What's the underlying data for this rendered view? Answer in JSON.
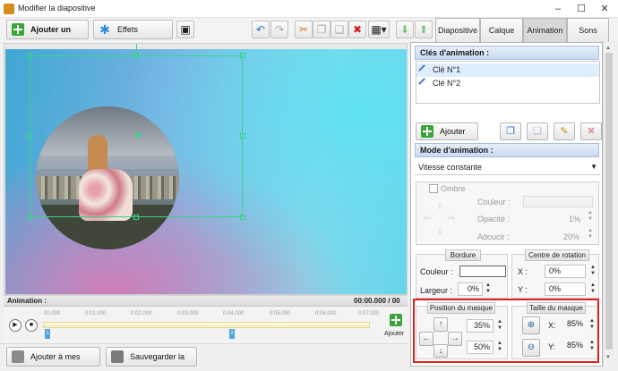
{
  "window": {
    "title": "Modifier la diapositive",
    "minimize": "–",
    "maximize": "☐",
    "close": "✕"
  },
  "toolbar": {
    "add_layer": "Ajouter un calque",
    "slide_effects": "Effets diapositive"
  },
  "tabs": [
    "Diapositive",
    "Calque",
    "Animation",
    "Sons"
  ],
  "active_tab": "Animation",
  "keyframes": {
    "header": "Clés d'animation :",
    "items": [
      "Clé N°1",
      "Clé N°2"
    ],
    "add_label": "Ajouter"
  },
  "mode": {
    "header": "Mode d'animation :",
    "value": "Vitesse constante"
  },
  "shadow": {
    "checkbox_label": "Ombre",
    "color_label": "Couleur :",
    "opacity_label": "Opacité :",
    "opacity_value": "1%",
    "soften_label": "Adoucir :",
    "soften_value": "20%"
  },
  "border": {
    "title": "Bordure",
    "color_label": "Couleur :",
    "width_label": "Largeur :",
    "width_value": "0%"
  },
  "rotation": {
    "title": "Centre de rotation",
    "x_label": "X :",
    "x_value": "0%",
    "y_label": "Y :",
    "y_value": "0%"
  },
  "mask_position": {
    "title": "Position du masque",
    "x_value": "35%",
    "y_value": "50%"
  },
  "mask_size": {
    "title": "Taille du masque",
    "x_label": "X:",
    "x_value": "85%",
    "y_label": "Y:",
    "y_value": "85%"
  },
  "timeline": {
    "label": "Animation :",
    "time_display": "00:00.000 / 00",
    "ticks": [
      "00.000",
      "0:01.000",
      "0:02.000",
      "0:03.000",
      "0:04.000",
      "0:05.000",
      "0:06.000",
      "0:07.000"
    ],
    "key_markers": [
      "1",
      "2"
    ],
    "add_label": "Ajouter"
  },
  "bottom": {
    "add_to_scenes": "Ajouter à mes scènes",
    "save_scene": "Sauvegarder la scène"
  },
  "colors": {
    "accent": "#3aa63a",
    "selection": "#38d48a",
    "highlight": "#e02020",
    "section_header": "#c9daf0"
  }
}
